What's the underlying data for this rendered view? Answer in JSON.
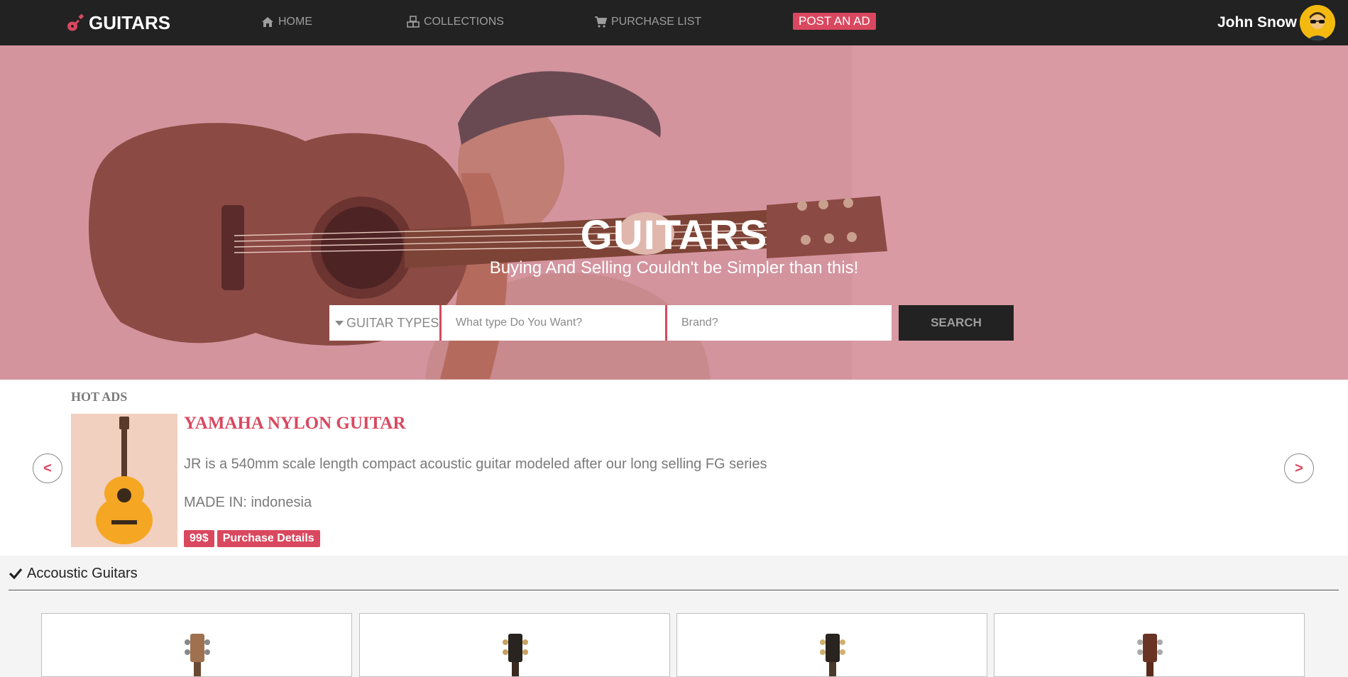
{
  "navbar": {
    "brand": "GUITARS",
    "brand_icon": "guitar-icon",
    "links": [
      {
        "label": "HOME",
        "icon": "home-icon"
      },
      {
        "label": "COLLECTIONS",
        "icon": "cubes-icon"
      },
      {
        "label": "PURCHASE LIST",
        "icon": "cart-icon"
      }
    ],
    "post_ad_label": "POST AN AD",
    "user_name": "John Snow",
    "avatar_icon": "avatar-icon"
  },
  "hero": {
    "title": "GUITARS",
    "subtitle": "Buying And Selling Couldn't be Simpler than this!",
    "types_label": "GUITAR TYPES",
    "type_placeholder": "What type Do You Want?",
    "brand_placeholder": "Brand?",
    "search_label": "SEARCH"
  },
  "hot_ads": {
    "heading": "HOT ADS",
    "prev_label": "<",
    "next_label": ">",
    "ad": {
      "title": "YAMAHA NYLON GUITAR",
      "description": "JR is a 540mm scale length compact acoustic guitar modeled after our long selling FG series",
      "made_in": "MADE IN: indonesia",
      "price": "99$",
      "details_label": "Purchase Details"
    }
  },
  "section": {
    "title": "Accoustic Guitars",
    "icon": "check-icon"
  },
  "colors": {
    "accent": "#d9485f",
    "navbar": "#222222",
    "hero_tint": "#d3949e"
  }
}
